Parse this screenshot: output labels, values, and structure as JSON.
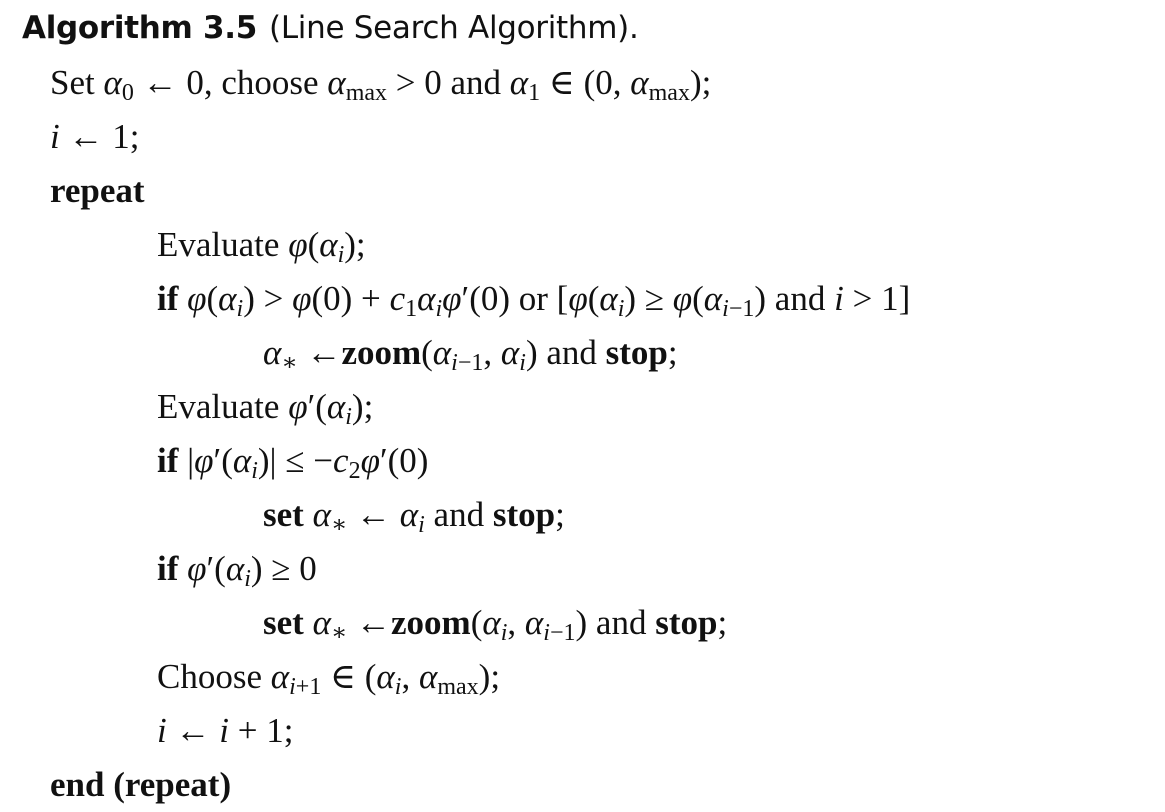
{
  "algorithm": {
    "label": "Algorithm 3.5",
    "subtitle": "(Line Search Algorithm).",
    "lines": [
      "Set α₀ ← 0, choose αmax > 0 and α₁ ∈ (0, αmax);",
      "i ← 1;",
      "repeat",
      "Evaluate φ(αᵢ);",
      "if φ(αᵢ) > φ(0) + c₁αᵢφ′(0) or [φ(αᵢ) ≥ φ(αᵢ₋₁) and i > 1]",
      "α* ←zoom(αᵢ₋₁, αᵢ) and stop;",
      "Evaluate φ′(αᵢ);",
      "if |φ′(αᵢ)| ≤ −c₂φ′(0)",
      "set α* ← αᵢ and stop;",
      "if φ′(αᵢ) ≥ 0",
      "set α* ←zoom(αᵢ, αᵢ₋₁) and stop;",
      "Choose αᵢ₊₁ ∈ (αᵢ, αmax);",
      "i ← i + 1;",
      "end (repeat)"
    ]
  }
}
